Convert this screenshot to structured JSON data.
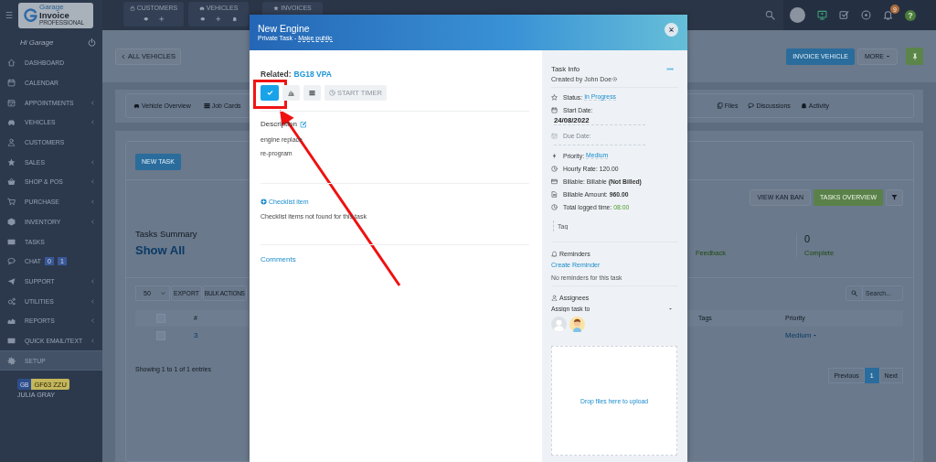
{
  "top_bar": {
    "menu": "☰",
    "quick_links": [
      {
        "label": "CUSTOMERS",
        "kind": "lock",
        "actions": [
          {
            "kind": "view"
          },
          {
            "kind": "add"
          }
        ]
      },
      {
        "label": "VEHICLES",
        "kind": "car",
        "actions": [
          {
            "kind": "view"
          },
          {
            "kind": "add"
          },
          {
            "kind": "alert"
          }
        ]
      },
      {
        "label": "INVOICES",
        "kind": "star"
      }
    ],
    "notification_count": "9",
    "help": "?"
  },
  "logo": {
    "line1": "Garage",
    "line2": "Invoice",
    "tagline": "PROFESSIONAL"
  },
  "sidebar": {
    "greeting": "Hi Garage",
    "items": [
      {
        "label": "DASHBOARD",
        "kind": "home",
        "has_submenu": false,
        "selected": false
      },
      {
        "label": "CALENDAR",
        "kind": "calendar",
        "has_submenu": false,
        "selected": false
      },
      {
        "label": "APPOINTMENTS",
        "kind": "calendar-check",
        "has_submenu": true,
        "selected": false
      },
      {
        "label": "VEHICLES",
        "kind": "car",
        "has_submenu": true,
        "selected": false
      },
      {
        "label": "CUSTOMERS",
        "kind": "user",
        "has_submenu": false,
        "selected": false
      },
      {
        "label": "SALES",
        "kind": "star",
        "has_submenu": true,
        "selected": false
      },
      {
        "label": "SHOP & POS",
        "kind": "basket",
        "has_submenu": true,
        "selected": false
      },
      {
        "label": "PURCHASE",
        "kind": "cart",
        "has_submenu": true,
        "selected": false
      },
      {
        "label": "INVENTORY",
        "kind": "box",
        "has_submenu": true,
        "selected": false
      },
      {
        "label": "TASKS",
        "kind": "card",
        "has_submenu": false,
        "selected": false
      },
      {
        "label": "CHAT",
        "kind": "chat",
        "has_submenu": false,
        "selected": false,
        "badges": [
          "0",
          "1"
        ]
      },
      {
        "label": "SUPPORT",
        "kind": "plane",
        "has_submenu": true,
        "selected": false
      },
      {
        "label": "UTILITIES",
        "kind": "gears",
        "has_submenu": true,
        "selected": false
      },
      {
        "label": "REPORTS",
        "kind": "chart",
        "has_submenu": true,
        "selected": false
      },
      {
        "label": "QUICK EMAIL/TEXT",
        "kind": "envelope",
        "has_submenu": true,
        "selected": false
      },
      {
        "label": "SETUP",
        "kind": "gear",
        "has_submenu": false,
        "selected": true
      }
    ],
    "vehicle": {
      "country": "GB",
      "plate": "GF63 ZZU",
      "owner": "JULIA GRAY"
    }
  },
  "page": {
    "back_button": "ALL VEHICLES",
    "invoice_button": "INVOICE VEHICLE",
    "more_button": "MORE",
    "tabs": [
      {
        "label": "Vehicle Overview",
        "kind": "car"
      },
      {
        "label": "Job Cards",
        "kind": "list"
      },
      {
        "label": "Files",
        "kind": "files"
      },
      {
        "label": "Discussions",
        "kind": "chat"
      },
      {
        "label": "Activity",
        "kind": "alert"
      }
    ],
    "new_task_button": "NEW TASK",
    "kanban_button": "VIEW KAN BAN",
    "overview_button": "TASKS OVERVIEW",
    "summary": {
      "title": "Tasks Summary",
      "filter": "Show All",
      "stats": [
        {
          "label": "Feedback"
        },
        {
          "value": "0",
          "label": "Complete"
        }
      ]
    },
    "table": {
      "page_size": "50",
      "export_button": "EXPORT",
      "bulk_button": "BULK ACTIONS",
      "search_placeholder": "Search...",
      "columns": [
        {
          "label": "#",
          "kind": "number"
        },
        {
          "label": "Tags",
          "kind": "tags"
        },
        {
          "label": "Priority",
          "kind": "priority"
        }
      ],
      "header_checked": false,
      "rows": [
        {
          "checked": false,
          "number": "3",
          "priority": "Medium"
        }
      ],
      "info": "Showing 1 to 1 of 1 entries",
      "pagination": {
        "previous": "Previous",
        "pages": [
          {
            "label": "1",
            "selected": true
          }
        ],
        "next": "Next"
      }
    }
  },
  "modal": {
    "title": "New Engine",
    "subtitle": "Private Task - ",
    "make_public_link": "Make public",
    "related_label": "Related:",
    "related_value": "BG18 VPA",
    "timer_button": "START TIMER",
    "description_title": "Description",
    "description_lines": [
      "engine replace",
      "re-program"
    ],
    "checklist_link": "Checklist item",
    "checklist_empty": "Checklist items not found for this task",
    "comments_title": "Comments",
    "info": {
      "title": "Task Info",
      "created_by": "Created by John Doe",
      "rows": [
        {
          "kind": "link",
          "label": "Status:",
          "value": "In Progress",
          "disabled": false
        },
        {
          "kind": "date",
          "label": "Start Date:",
          "value": "24/08/2022",
          "disabled": false
        },
        {
          "kind": "date",
          "label": "Due Date:",
          "disabled": true
        }
      ],
      "details": [
        {
          "kind": "link",
          "label": "Priority:",
          "value": "Medium"
        },
        {
          "kind": "plain",
          "label": "Hourly Rate:",
          "value": "120.00"
        },
        {
          "kind": "rich",
          "label": "Billable:",
          "value": "Billable **(Not Billed)**"
        },
        {
          "kind": "bold",
          "label": "Billable Amount:",
          "value": "960.00"
        },
        {
          "kind": "time",
          "label": "Total logged time:",
          "value": "08:00"
        }
      ],
      "tag_placeholder": "Tag"
    },
    "reminders": {
      "title": "Reminders",
      "create_link": "Create Reminder",
      "empty": "No reminders for this task"
    },
    "assignees": {
      "title": "Assignees",
      "placeholder": "Assign task to",
      "people": [
        {
          "kind": "default"
        },
        {
          "kind": "cartoon"
        }
      ]
    },
    "dropzone": "Drop files here to upload"
  }
}
